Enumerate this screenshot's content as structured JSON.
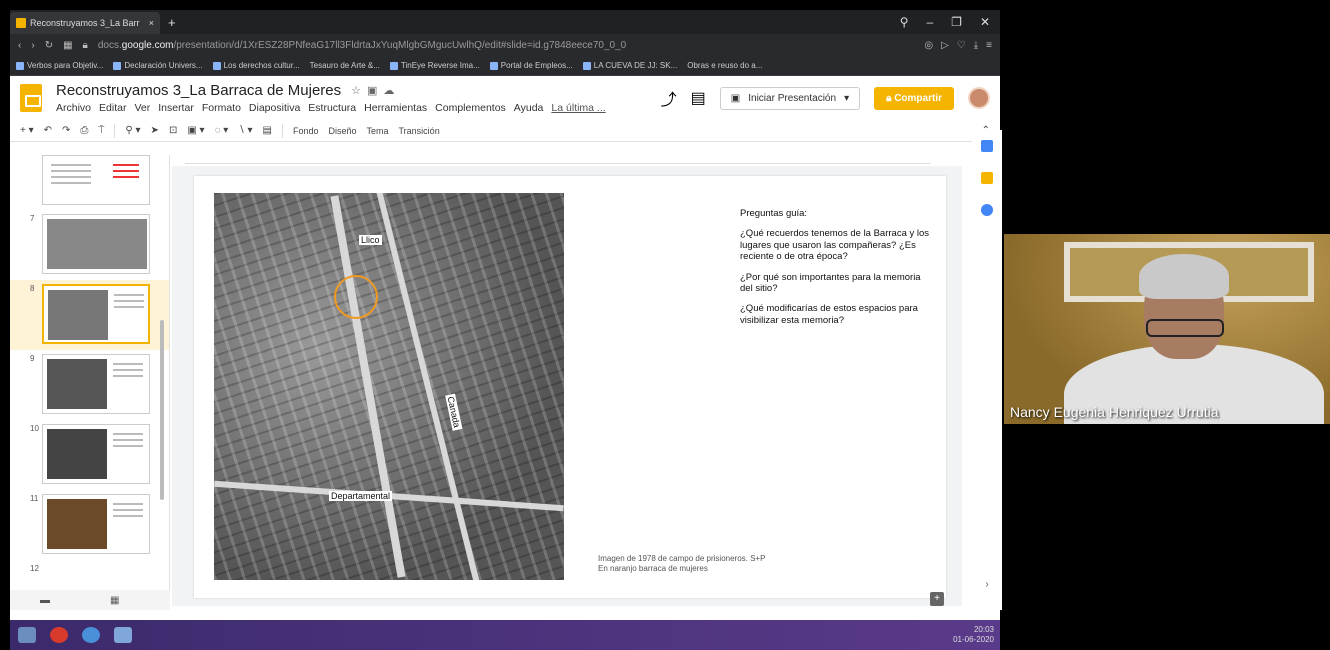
{
  "browser": {
    "tab_title": "Reconstruyamos 3_La Barr",
    "tab_close": "×",
    "new_tab": "+",
    "url_prefix": "docs.",
    "url_domain": "google.com",
    "url_rest": "/presentation/d/1XrESZ28PNfeaG17ll3FldrtaJxYuqMlgbGMgucUwlhQ/edit#slide=id.g7848eece70_0_0",
    "bookmarks": [
      "Verbos para Objetiv...",
      "Declaración Univers...",
      "Los derechos cultur...",
      "Tesauro de Arte &...",
      "TinEye Reverse Ima...",
      "Portal de Empleos...",
      "LA CUEVA DE JJ: SK...",
      "Obras e reuso do a..."
    ]
  },
  "slides": {
    "doc_title": "Reconstruyamos 3_La Barraca de Mujeres",
    "menu": [
      "Archivo",
      "Editar",
      "Ver",
      "Insertar",
      "Formato",
      "Diapositiva",
      "Estructura",
      "Herramientas",
      "Complementos",
      "Ayuda"
    ],
    "last_edit": "La última ...",
    "present_label": "Iniciar Presentación",
    "share_label": "Compartir",
    "toolbar": [
      "Fondo",
      "Diseño",
      "Tema",
      "Transición"
    ]
  },
  "filmstrip": {
    "numbers": [
      "7",
      "8",
      "9",
      "10",
      "11",
      "12"
    ]
  },
  "slide": {
    "photo_labels": {
      "llico": "Llico",
      "canada": "Canada",
      "departamental": "Departamental"
    },
    "heading": "Preguntas guía:",
    "q1": "¿Qué recuerdos tenemos de la Barraca y los lugares que usaron las compañeras? ¿Es reciente o de otra época?",
    "q2": "¿Por qué son importantes para la memoria del sitio?",
    "q3": "¿Qué modificarías de estos espacios para visibilizar esta memoria?",
    "caption1": "Imagen de 1978 de campo de prisioneros. S+P",
    "caption2": "En naranjo barraca de mujeres"
  },
  "taskbar": {
    "time": "20:03",
    "date": "01-06-2020"
  },
  "webcam": {
    "name": "Nancy Eugenia Henriquez Urrutia"
  },
  "colors": {
    "accent": "#f4b400",
    "highlight": "#f19a1f",
    "taskbar": "#3b2a6b"
  }
}
